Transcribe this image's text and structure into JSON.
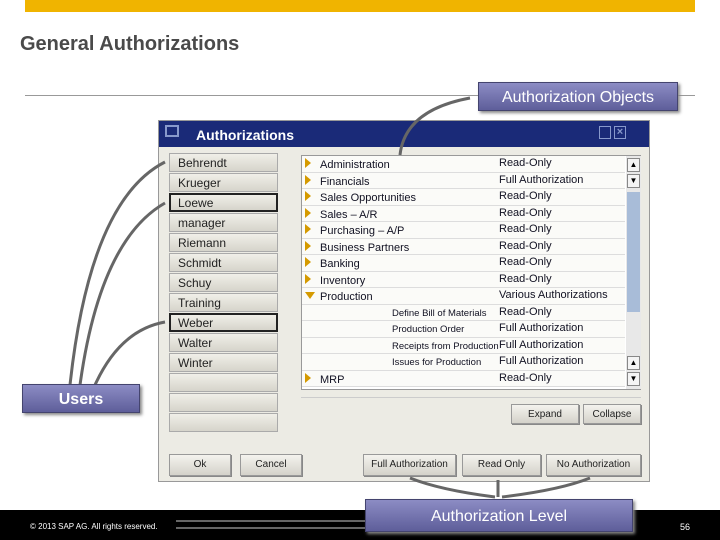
{
  "slide": {
    "title": "General Authorizations",
    "page": "56",
    "copyright": "© 2013 SAP AG. All rights reserved."
  },
  "callouts": {
    "objects": "Authorization Objects",
    "users": "Users",
    "level": "Authorization Level"
  },
  "dialog": {
    "title": "Authorizations",
    "users": [
      "Behrendt",
      "Krueger",
      "Loewe",
      "manager",
      "Riemann",
      "Schmidt",
      "Schuy",
      "Training",
      "Weber",
      "Walter",
      "Winter"
    ],
    "selected_users": [
      "Loewe",
      "Weber"
    ],
    "objects": [
      {
        "name": "Administration",
        "level": "Read-Only"
      },
      {
        "name": "Financials",
        "level": "Full Authorization"
      },
      {
        "name": "Sales Opportunities",
        "level": "Read-Only"
      },
      {
        "name": "Sales – A/R",
        "level": "Read-Only"
      },
      {
        "name": "Purchasing – A/P",
        "level": "Read-Only"
      },
      {
        "name": "Business Partners",
        "level": "Read-Only"
      },
      {
        "name": "Banking",
        "level": "Read-Only"
      },
      {
        "name": "Inventory",
        "level": "Read-Only"
      },
      {
        "name": "Production",
        "level": "Various Authorizations",
        "expanded": true
      },
      {
        "sub": "Define Bill of Materials",
        "level": "Read-Only"
      },
      {
        "sub": "Production Order",
        "level": "Full Authorization"
      },
      {
        "sub": "Receipts from Production",
        "level": "Full Authorization"
      },
      {
        "sub": "Issues for Production",
        "level": "Full Authorization"
      },
      {
        "name": "MRP",
        "level": "Read-Only"
      }
    ],
    "buttons": {
      "expand": "Expand",
      "collapse": "Collapse",
      "ok": "Ok",
      "cancel": "Cancel",
      "full": "Full Authorization",
      "read": "Read Only",
      "none": "No Authorization"
    }
  },
  "colors": {
    "accent": "#f0b400",
    "titlebar": "#1a2a78",
    "callout": "#7676b0"
  }
}
